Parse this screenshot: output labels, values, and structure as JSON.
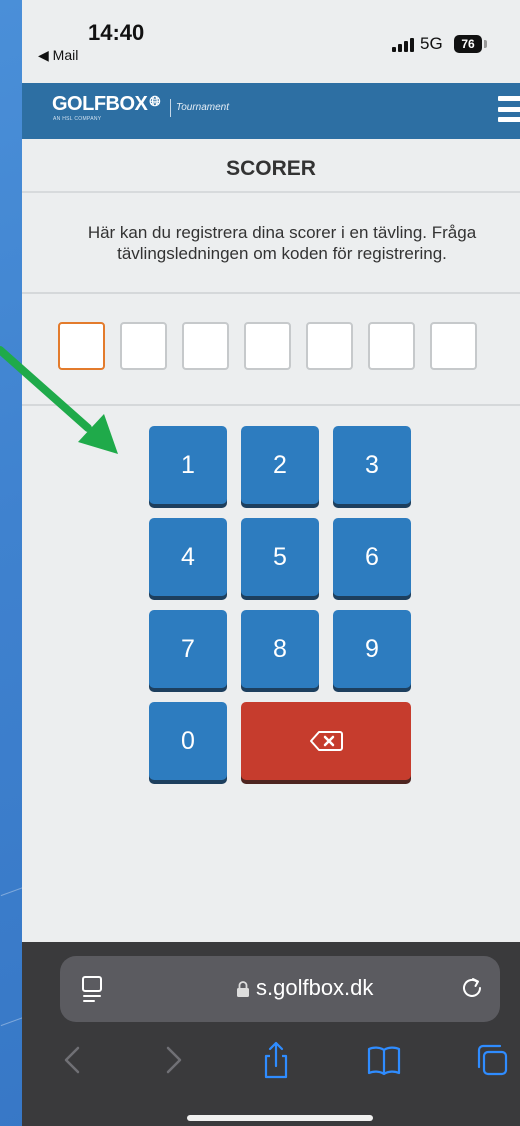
{
  "status_bar": {
    "time": "14:40",
    "back_label": "◀ Mail",
    "network": "5G",
    "battery": "76"
  },
  "header": {
    "logo": "GOLFBOX",
    "logo_sub": "AN HSL COMPANY",
    "product": "Tournament"
  },
  "page": {
    "title": "SCORER",
    "info": "Här kan du registrera dina scorer i en tävling. Fråga tävlingsledningen om koden för registrering."
  },
  "code_length": 7,
  "keypad": {
    "k1": "1",
    "k2": "2",
    "k3": "3",
    "k4": "4",
    "k5": "5",
    "k6": "6",
    "k7": "7",
    "k8": "8",
    "k9": "9",
    "k0": "0"
  },
  "browser": {
    "url": "s.golfbox.dk"
  },
  "colors": {
    "header": "#2d6fa3",
    "key": "#2d7cbf",
    "delete_key": "#c63c2d",
    "active_box": "#e37b2c",
    "arrow": "#1faa4a"
  }
}
